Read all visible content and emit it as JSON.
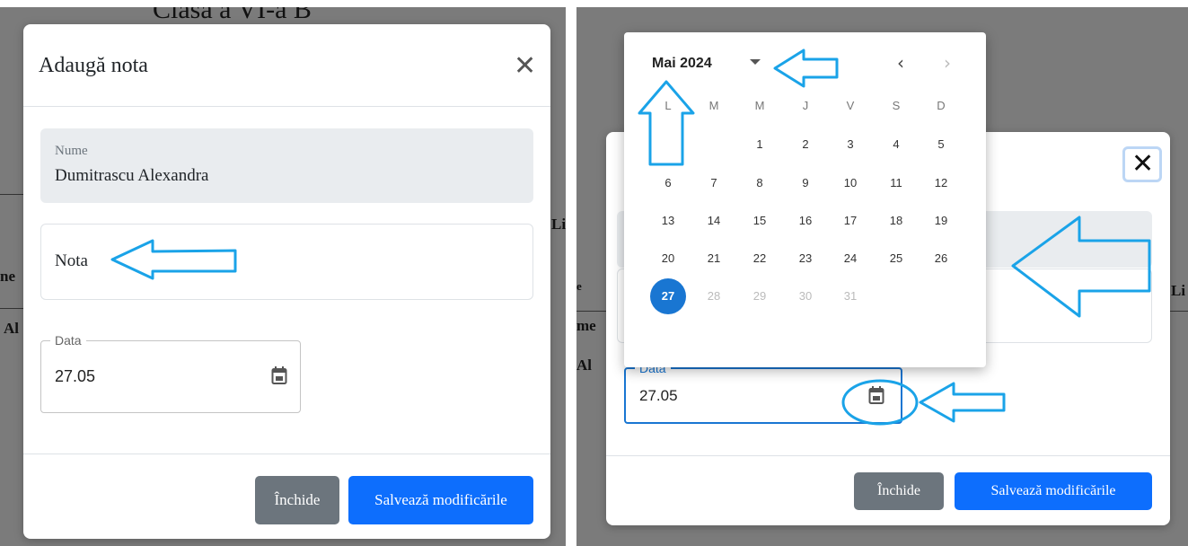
{
  "left": {
    "background_title": "Clasa a VI-a B",
    "background_fragments": [
      "ne",
      "Al",
      "Li"
    ],
    "modal": {
      "title": "Adaugă nota",
      "name_label": "Nume",
      "name_value": "Dumitrascu Alexandra",
      "grade_placeholder": "Nota",
      "date_label": "Data",
      "date_value": "27.05",
      "close_button": "Închide",
      "save_button": "Salvează modificările"
    }
  },
  "right": {
    "background_fragments": [
      "me",
      "Al",
      "Li",
      "e"
    ],
    "modal": {
      "date_label": "Data",
      "date_value": "27.05",
      "close_button": "Închide",
      "save_button": "Salvează modificările"
    },
    "calendar": {
      "month_label": "Mai 2024",
      "weekdays": [
        "L",
        "M",
        "M",
        "J",
        "V",
        "S",
        "D"
      ],
      "selected_day": "27"
    }
  },
  "colors": {
    "primary": "#0d6efd",
    "secondary": "#6c757d",
    "picker_selected": "#1976d2",
    "annotation_arrow": "#1aa3e8"
  },
  "icons": [
    "close-icon",
    "calendar-icon",
    "chevron-left-icon",
    "chevron-right-icon",
    "caret-down-icon"
  ]
}
